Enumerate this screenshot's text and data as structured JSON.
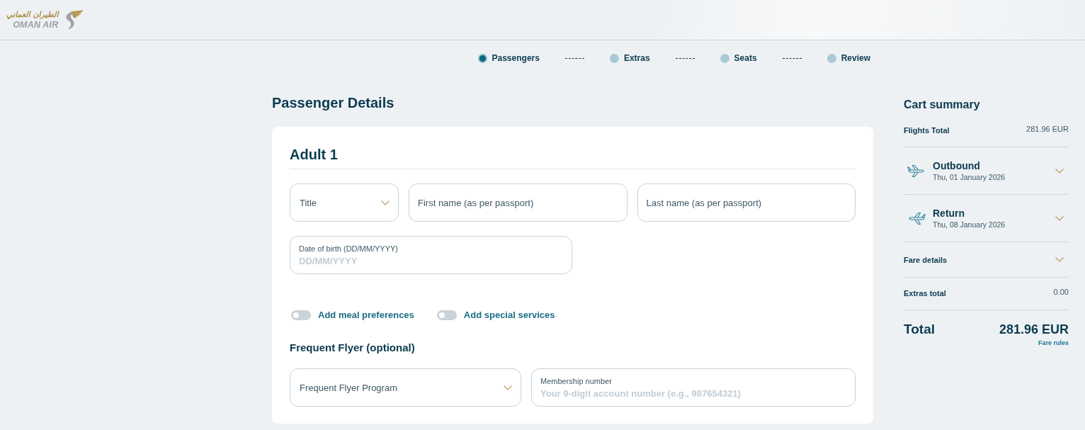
{
  "logo": {
    "arabic_name": "الطيران العماني",
    "latin_name": "OMAN AIR"
  },
  "steps": [
    {
      "label": "Passengers",
      "selected": true
    },
    {
      "label": "Extras",
      "selected": false
    },
    {
      "label": "Seats",
      "selected": false
    },
    {
      "label": "Review",
      "selected": false
    }
  ],
  "page_title": "Passenger Details",
  "passenger": {
    "heading": "Adult 1",
    "name_fields": [
      {
        "kind": "select",
        "placeholder": "Title"
      },
      {
        "kind": "input",
        "placeholder": "First name (as per passport)"
      },
      {
        "kind": "input",
        "placeholder": "Last name (as per passport)"
      }
    ],
    "birth_fields": [
      {
        "kind": "labeled_input",
        "label": "Date of birth (DD/MM/YYYY)",
        "placeholder": "DD/MM/YYYY"
      }
    ],
    "toggles": [
      {
        "label": "Add meal preferences",
        "on": false
      },
      {
        "label": "Add special services",
        "on": false
      }
    ],
    "frequent_flyer": {
      "heading": "Frequent Flyer (optional)",
      "fields": [
        {
          "kind": "select",
          "placeholder": "Frequent Flyer Program"
        },
        {
          "kind": "labeled_input",
          "label": "Membership number",
          "placeholder": "Your 9-digit account number (e.g., 987654321)"
        }
      ]
    }
  },
  "cart": {
    "title": "Cart summary",
    "rows": [
      {
        "kind": "amount",
        "label": "Flights Total",
        "value": "281.96 EUR"
      },
      {
        "kind": "outbound",
        "title": "Outbound",
        "date": "Thu, 01 January 2026",
        "expanded": false
      },
      {
        "kind": "return",
        "title": "Return",
        "date": "Thu, 08 January 2026",
        "expanded": false
      },
      {
        "kind": "accordion",
        "label": "Fare details",
        "expanded": false
      },
      {
        "kind": "amount",
        "label": "Extras total",
        "value": "0.00"
      }
    ],
    "total": {
      "label": "Total",
      "value": "281.96 EUR",
      "link": "Fare rules"
    }
  }
}
